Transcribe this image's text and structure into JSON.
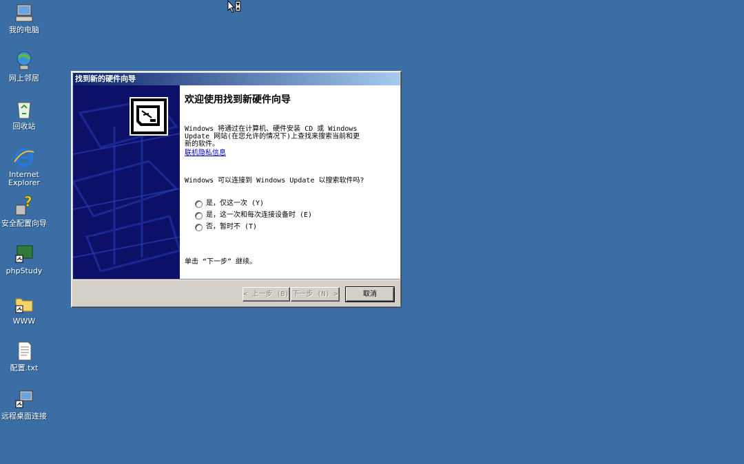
{
  "desktop": {
    "icons": [
      {
        "label": "我的电脑",
        "icon": "my-computer-icon"
      },
      {
        "label": "网上邻居",
        "icon": "network-places-icon"
      },
      {
        "label": "回收站",
        "icon": "recycle-bin-icon"
      },
      {
        "label": "Internet Explorer",
        "icon": "ie-icon"
      },
      {
        "label": "安全配置向导",
        "icon": "security-wizard-icon"
      },
      {
        "label": "phpStudy",
        "icon": "phpstudy-icon"
      },
      {
        "label": "WWW",
        "icon": "folder-shortcut-icon"
      },
      {
        "label": "配置.txt",
        "icon": "text-file-icon"
      },
      {
        "label": "远程桌面连接",
        "icon": "remote-desktop-icon"
      }
    ],
    "background_color": "#3a6ea5"
  },
  "wizard": {
    "title": "找到新的硬件向导",
    "heading": "欢迎使用找到新硬件向导",
    "intro_line1": "Windows 将通过在计算机、硬件安装 CD 或 Windows",
    "intro_line2": "Update 网站(在您允许的情况下)上查找来搜索当前和更",
    "intro_line3": "新的软件。",
    "privacy_link": "联机隐私信息",
    "question": "Windows 可以连接到 Windows Update 以搜索软件吗?",
    "options": [
      {
        "label": "是，仅这一次 (Y)"
      },
      {
        "label": "是，这一次和每次连接设备时 (E)"
      },
      {
        "label": "否，暂时不 (T)"
      }
    ],
    "continue_hint": "单击 “下一步” 继续。",
    "buttons": {
      "back": "< 上一步 (B)",
      "next": "下一步 (N) >",
      "cancel": "取消"
    },
    "titlebar_color": "#0a246a",
    "side_panel_color": "#0c1066"
  }
}
